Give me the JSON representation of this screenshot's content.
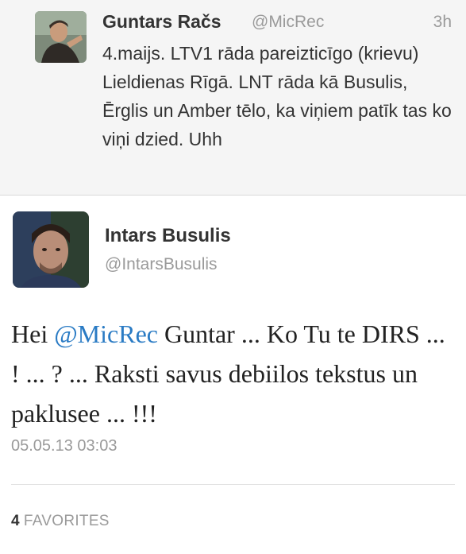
{
  "reply_tweet": {
    "author_name": "Guntars Račs",
    "author_handle": "@MicRec",
    "time_ago": "3h",
    "text": "4.maijs. LTV1 rāda pareizticīgo (krievu) Lieldienas Rīgā. LNT rāda kā Busulis,  Ērglis un Amber tēlo, ka viņiem patīk tas ko viņi dzied. Uhh",
    "avatar_icon": "user-photo-avatar"
  },
  "main_tweet": {
    "author_name": "Intars Busulis",
    "author_handle": "@IntarsBusulis",
    "avatar_icon": "user-photo-avatar",
    "text_before_mention": "Hei ",
    "mention": "@MicRec",
    "text_after_mention": " Guntar ... Ko Tu te DIRS ... ! ... ? ... Raksti savus debiilos tekstus un paklusee ... !!!",
    "timestamp": "05.05.13 03:03",
    "favorites_count": "4",
    "favorites_label": "FAVORITES"
  },
  "colors": {
    "link": "#2a7bc4",
    "muted_text": "#9a9a9a",
    "reply_background": "#f5f5f5"
  }
}
